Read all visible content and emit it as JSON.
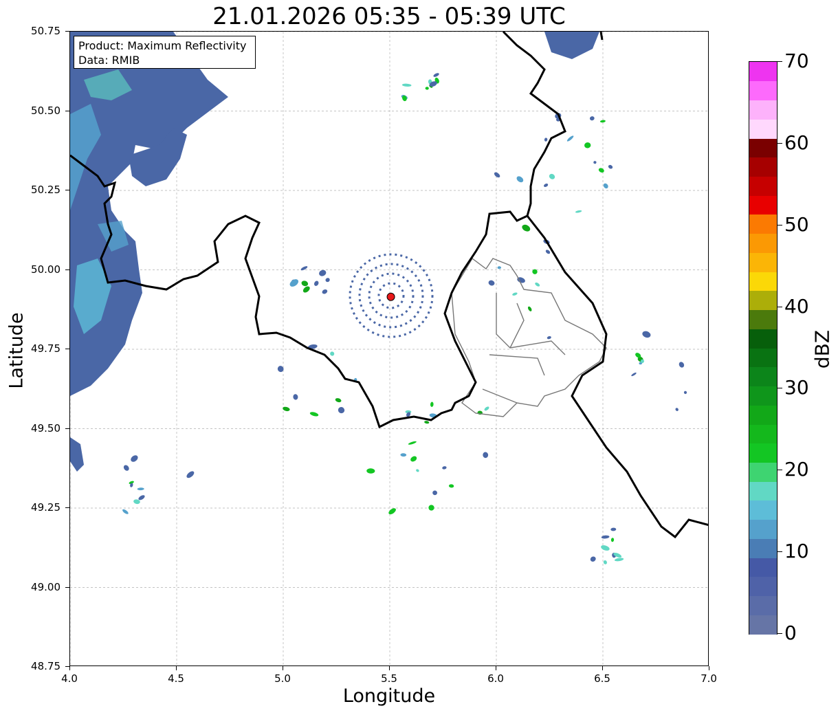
{
  "title": "21.01.2026 05:35 - 05:39 UTC",
  "info_box": {
    "product": "Product: Maximum Reflectivity",
    "source": "Data: RMIB"
  },
  "axes": {
    "xlabel": "Longitude",
    "ylabel": "Latitude",
    "xlim": [
      4.0,
      7.0
    ],
    "ylim": [
      48.75,
      50.75
    ],
    "xticks": [
      "4.0",
      "4.5",
      "5.0",
      "5.5",
      "6.0",
      "6.5",
      "7.0"
    ],
    "yticks": [
      "50.75",
      "50.50",
      "50.25",
      "50.00",
      "49.75",
      "49.50",
      "49.25",
      "49.00",
      "48.75"
    ],
    "grid": true
  },
  "radar_site": {
    "lon": 5.505,
    "lat": 49.915,
    "color": "#e8191a"
  },
  "colorbar": {
    "unit": "dBZ",
    "min": 0,
    "max": 70,
    "tick_labels": [
      "0",
      "10",
      "20",
      "30",
      "40",
      "50",
      "60",
      "70"
    ],
    "colors": [
      "#6675a6",
      "#5a6ca8",
      "#4f62a8",
      "#4559a6",
      "#4a7db5",
      "#55a1cc",
      "#5dbdd8",
      "#61d8c4",
      "#3ed471",
      "#13c623",
      "#14b81c",
      "#12a818",
      "#0f961b",
      "#0c851a",
      "#097312",
      "#075f0b",
      "#4b7a0c",
      "#acae09",
      "#fbd807",
      "#fbb506",
      "#fb9904",
      "#fb7a02",
      "#e80000",
      "#c60000",
      "#a60000",
      "#7a0000",
      "#ffd8fd",
      "#fdb2fb",
      "#fd6afc",
      "#ee34f0"
    ]
  },
  "legend": {
    "position": "top-left"
  }
}
